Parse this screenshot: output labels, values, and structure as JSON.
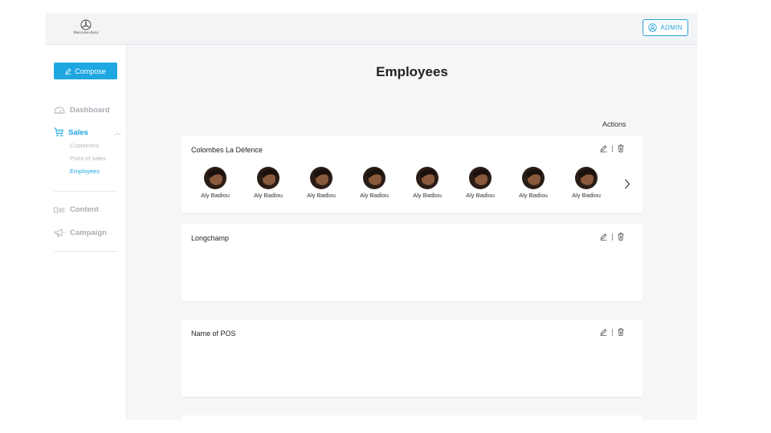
{
  "brand": {
    "logo_text": "Mercedes-Benz",
    "accent_color": "#1ea7e1"
  },
  "header": {
    "admin_label": "ADMIN",
    "admin_icon": "user-circle-icon"
  },
  "sidebar": {
    "compose_label": "Compose",
    "nav": [
      {
        "label": "Dashboard",
        "icon": "dashboard-gauge-icon"
      },
      {
        "label": "Sales",
        "icon": "cart-icon",
        "active": true,
        "children": [
          {
            "label": "Customers"
          },
          {
            "label": "Point of sales"
          },
          {
            "label": "Employees",
            "active": true
          }
        ]
      },
      {
        "label": "Content",
        "icon": "content-list-icon"
      },
      {
        "label": "Campaign",
        "icon": "megaphone-icon"
      }
    ]
  },
  "main": {
    "title": "Employees",
    "actions_label": "Actions",
    "cards": [
      {
        "name": "Colombes La Défence",
        "employees": [
          "Aly Badiou",
          "Aly Badiou",
          "Aly Badiou",
          "Aly Badiou",
          "Aly Badiou",
          "Aly Badiou",
          "Aly Badiou",
          "Aly Badiou"
        ]
      },
      {
        "name": "Longchamp",
        "employees": []
      },
      {
        "name": "Name of POS",
        "employees": []
      },
      {
        "name": "",
        "employees": []
      }
    ]
  }
}
